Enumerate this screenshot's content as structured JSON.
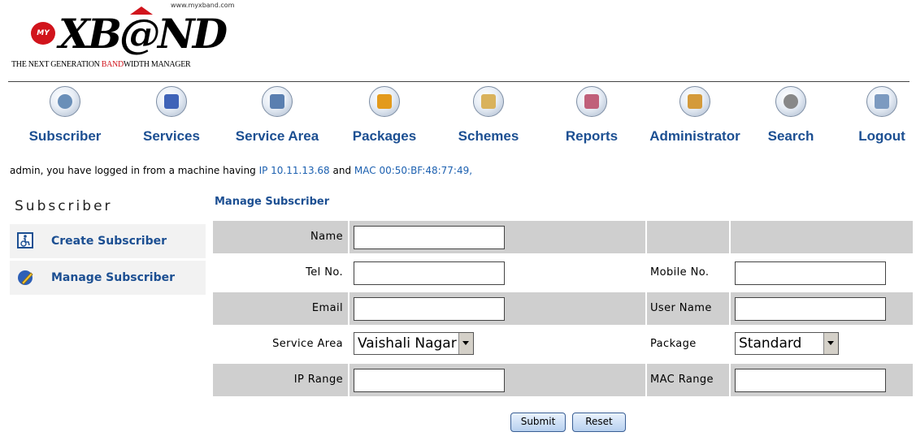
{
  "logo": {
    "url_text": "www.myxband.com",
    "badge": "MY",
    "brand": "XB@ND",
    "tagline_a": "THE NEXT GENERATION ",
    "tagline_b": "BAND",
    "tagline_c": "WIDTH MANAGER"
  },
  "nav": {
    "items": [
      {
        "label": "Subscriber",
        "icon": "subscriber-icon"
      },
      {
        "label": "Services",
        "icon": "services-icon"
      },
      {
        "label": "Service Area",
        "icon": "service-area-icon"
      },
      {
        "label": "Packages",
        "icon": "packages-icon"
      },
      {
        "label": "Schemes",
        "icon": "schemes-icon"
      },
      {
        "label": "Reports",
        "icon": "reports-icon"
      },
      {
        "label": "Administrator",
        "icon": "administrator-icon"
      },
      {
        "label": "Search",
        "icon": "search-icon"
      },
      {
        "label": "Logout",
        "icon": "logout-icon"
      }
    ]
  },
  "info": {
    "prefix": "admin, you have logged in from a machine having ",
    "ip": "IP 10.11.13.68",
    "mid": " and ",
    "mac": "MAC 00:50:BF:48:77:49,"
  },
  "sidebar": {
    "title": "Subscriber",
    "items": [
      {
        "label": "Create Subscriber",
        "icon": "wheelchair-icon"
      },
      {
        "label": "Manage Subscriber",
        "icon": "pencil-icon"
      }
    ]
  },
  "main": {
    "title": "Manage Subscriber",
    "fields": {
      "name": "Name",
      "tel": "Tel No.",
      "mobile": "Mobile No.",
      "email": "Email",
      "username": "User Name",
      "service_area": "Service Area",
      "service_area_value": "Vaishali Nagar",
      "package": "Package",
      "package_value": "Standard",
      "ip_range": "IP Range",
      "mac_range": "MAC Range"
    },
    "submit": "Submit",
    "reset": "Reset"
  },
  "colors": {
    "nav_text": "#1c4f92",
    "shade": "#cfcfcf",
    "logo_red": "#d1141c"
  }
}
